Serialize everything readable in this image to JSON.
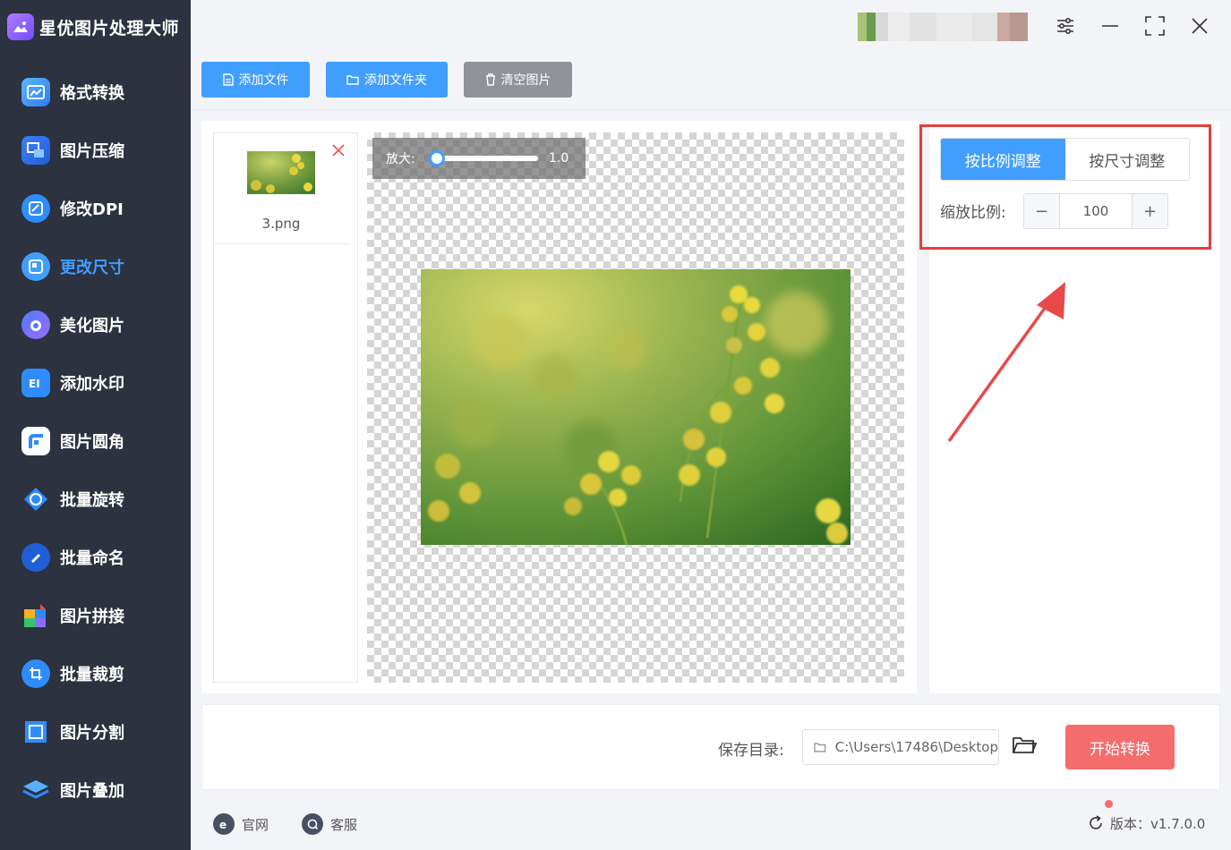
{
  "app": {
    "title": "星优图片处理大师",
    "brand_color": "#409eff",
    "sidebar_bg": "#2c323f"
  },
  "sidebar": {
    "items": [
      {
        "label": "格式转换",
        "icon": "format-convert-icon",
        "active": false
      },
      {
        "label": "图片压缩",
        "icon": "compress-icon",
        "active": false
      },
      {
        "label": "修改DPI",
        "icon": "dpi-icon",
        "active": false
      },
      {
        "label": "更改尺寸",
        "icon": "resize-icon",
        "active": true
      },
      {
        "label": "美化图片",
        "icon": "beautify-icon",
        "active": false
      },
      {
        "label": "添加水印",
        "icon": "watermark-icon",
        "active": false
      },
      {
        "label": "图片圆角",
        "icon": "round-corner-icon",
        "active": false
      },
      {
        "label": "批量旋转",
        "icon": "rotate-icon",
        "active": false
      },
      {
        "label": "批量命名",
        "icon": "rename-icon",
        "active": false
      },
      {
        "label": "图片拼接",
        "icon": "splice-icon",
        "active": false
      },
      {
        "label": "批量裁剪",
        "icon": "crop-icon",
        "active": false
      },
      {
        "label": "图片分割",
        "icon": "split-icon",
        "active": false
      },
      {
        "label": "图片叠加",
        "icon": "overlay-icon",
        "active": false
      }
    ]
  },
  "window": {
    "settings_icon": "sliders-icon",
    "minimize_icon": "minimize-icon",
    "maximize_icon": "maximize-icon",
    "close_icon": "close-icon"
  },
  "toolbar": {
    "add_file": "添加文件",
    "add_folder": "添加文件夹",
    "clear": "清空图片"
  },
  "files": [
    {
      "name": "3.png"
    }
  ],
  "preview": {
    "zoom_label": "放大:",
    "zoom_value": "1.0",
    "zoom_fraction": 0.0
  },
  "settings": {
    "mode_ratio": "按比例调整",
    "mode_size": "按尺寸调整",
    "active_mode": "ratio",
    "scale_label": "缩放比例:",
    "scale_value": "100",
    "minus": "−",
    "plus": "+"
  },
  "bottom": {
    "save_label": "保存目录:",
    "save_path": "C:\\Users\\17486\\Desktop",
    "start_button": "开始转换"
  },
  "footer": {
    "website": "官网",
    "support": "客服",
    "version": "版本：v1.7.0.0"
  }
}
